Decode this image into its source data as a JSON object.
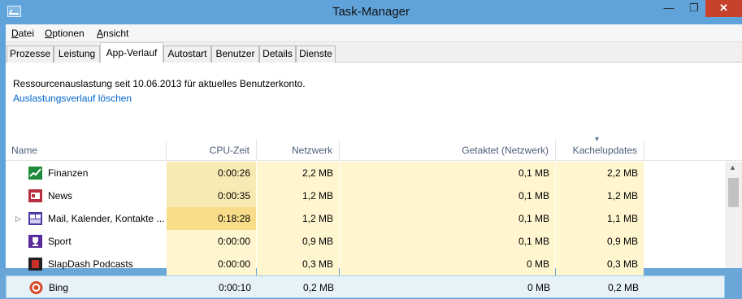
{
  "window": {
    "title": "Task-Manager",
    "minimize": "—",
    "maximize": "❐",
    "close": "✕"
  },
  "menu": [
    "Datei",
    "Optionen",
    "Ansicht"
  ],
  "tabs": [
    "Prozesse",
    "Leistung",
    "App-Verlauf",
    "Autostart",
    "Benutzer",
    "Details",
    "Dienste"
  ],
  "active_tab": "App-Verlauf",
  "info_text": "Ressourcenauslastung seit 10.06.2013 für aktuelles Benutzerkonto.",
  "delete_link": "Auslastungsverlauf löschen",
  "columns": {
    "name": "Name",
    "cpu": "CPU-Zeit",
    "net": "Netzwerk",
    "metered": "Getaktet (Netzwerk)",
    "tiles": "Kachelupdates"
  },
  "colors": {
    "cell_light": "#fff5cf",
    "cell_mid": "#f8eab4",
    "cell_strong": "#f8dc89",
    "accent": "#0066cc"
  },
  "rows": [
    {
      "name": "Finanzen",
      "cpu": "0:00:26",
      "net": "2,2 MB",
      "metered": "0,1 MB",
      "tiles": "2,2 MB",
      "icon": "finance-icon",
      "expandable": false,
      "selected": false
    },
    {
      "name": "News",
      "cpu": "0:00:35",
      "net": "1,2 MB",
      "metered": "0,1 MB",
      "tiles": "1,2 MB",
      "icon": "news-icon",
      "expandable": false,
      "selected": false
    },
    {
      "name": "Mail, Kalender, Kontakte ...",
      "cpu": "0:18:28",
      "net": "1,2 MB",
      "metered": "0,1 MB",
      "tiles": "1,1 MB",
      "icon": "mail-calendar-icon",
      "expandable": true,
      "selected": false
    },
    {
      "name": "Sport",
      "cpu": "0:00:00",
      "net": "0,9 MB",
      "metered": "0,1 MB",
      "tiles": "0,9 MB",
      "icon": "sport-trophy-icon",
      "expandable": false,
      "selected": false
    },
    {
      "name": "SlapDash Podcasts",
      "cpu": "0:00:00",
      "net": "0,3 MB",
      "metered": "0 MB",
      "tiles": "0,3 MB",
      "icon": "podcast-icon",
      "expandable": false,
      "selected": false
    },
    {
      "name": "Bing",
      "cpu": "0:00:10",
      "net": "0,2 MB",
      "metered": "0 MB",
      "tiles": "0,2 MB",
      "icon": "bing-icon",
      "expandable": false,
      "selected": true
    }
  ]
}
